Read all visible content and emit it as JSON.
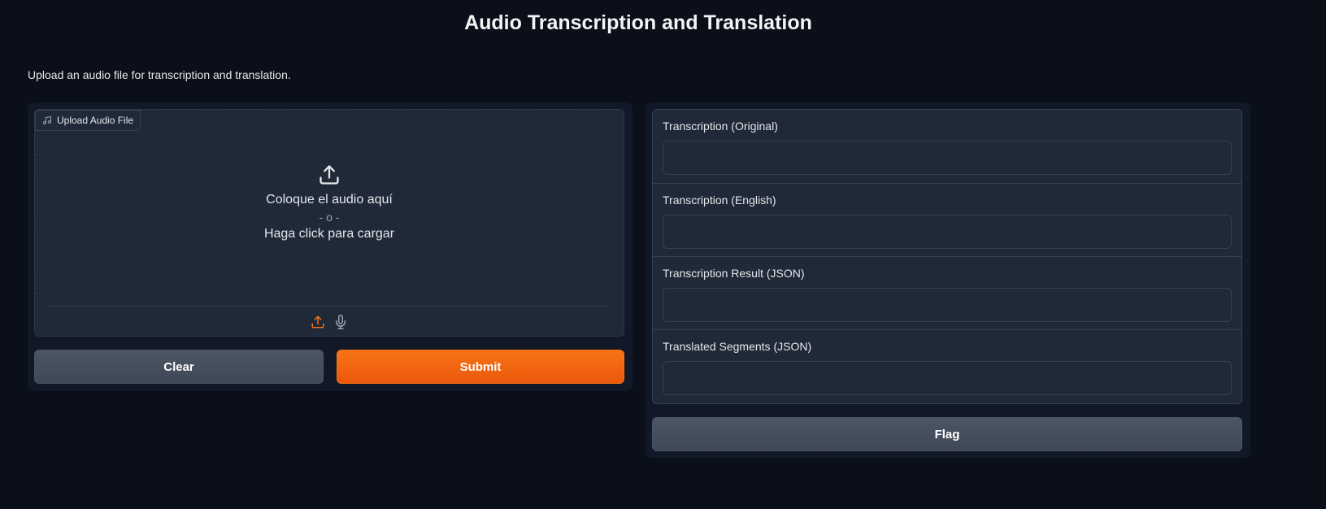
{
  "page": {
    "title": "Audio Transcription and Translation",
    "description": "Upload an audio file for transcription and translation."
  },
  "input_panel": {
    "upload_label": "Upload Audio File",
    "drop_text": "Coloque el audio aquí",
    "or_text": "- o -",
    "click_text": "Haga click para cargar",
    "source_icons": [
      "upload-icon",
      "microphone-icon"
    ],
    "clear_label": "Clear",
    "submit_label": "Submit"
  },
  "output_panel": {
    "fields": [
      {
        "label": "Transcription (Original)",
        "value": ""
      },
      {
        "label": "Transcription (English)",
        "value": ""
      },
      {
        "label": "Transcription Result (JSON)",
        "value": ""
      },
      {
        "label": "Translated Segments (JSON)",
        "value": ""
      }
    ],
    "flag_label": "Flag"
  },
  "colors": {
    "background": "#0b0f19",
    "panel": "#111827",
    "block": "#1f2937",
    "border": "#374151",
    "accent": "#f97316",
    "secondary_button": "#4b5563"
  }
}
